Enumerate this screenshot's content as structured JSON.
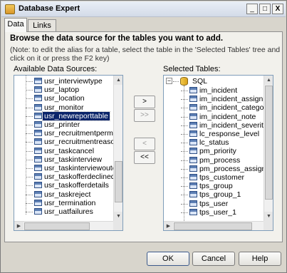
{
  "window": {
    "title": "Database Expert",
    "controls": {
      "minimize": "_",
      "maximize": "□",
      "close": "X"
    }
  },
  "tabs": [
    {
      "label": "Data",
      "active": true
    },
    {
      "label": "Links",
      "active": false
    }
  ],
  "content": {
    "heading": "Browse the data source for the tables you want to add.",
    "note": "(Note: to edit the alias for a table, select the table in the 'Selected Tables' tree and click on it or press the F2 key)"
  },
  "available": {
    "label": "Available Data Sources:",
    "items": [
      {
        "label": "usr_interviewtype"
      },
      {
        "label": "usr_laptop"
      },
      {
        "label": "usr_location"
      },
      {
        "label": "usr_monitor"
      },
      {
        "label": "usr_newreporttable",
        "selected": true
      },
      {
        "label": "usr_printer"
      },
      {
        "label": "usr_recruitmentpermtemp"
      },
      {
        "label": "usr_recruitmentreason"
      },
      {
        "label": "usr_taskcancel"
      },
      {
        "label": "usr_taskinterview"
      },
      {
        "label": "usr_taskinterviewoutcome"
      },
      {
        "label": "usr_taskofferdeclined"
      },
      {
        "label": "usr_taskofferdetails"
      },
      {
        "label": "usr_taskreject"
      },
      {
        "label": "usr_termination"
      },
      {
        "label": "usr_uatfailures"
      }
    ]
  },
  "transfer": {
    "add": ">",
    "add_all": ">>",
    "remove": "<",
    "remove_all": "<<"
  },
  "selected": {
    "label": "Selected Tables:",
    "root": {
      "label": "SQL",
      "expander": "−"
    },
    "items": [
      {
        "label": "im_incident"
      },
      {
        "label": "im_incident_assignment"
      },
      {
        "label": "im_incident_category"
      },
      {
        "label": "im_incident_note"
      },
      {
        "label": "im_incident_severity"
      },
      {
        "label": "lc_response_level"
      },
      {
        "label": "lc_status"
      },
      {
        "label": "pm_priority"
      },
      {
        "label": "pm_process"
      },
      {
        "label": "pm_process_assignment"
      },
      {
        "label": "tps_customer"
      },
      {
        "label": "tps_group"
      },
      {
        "label": "tps_group_1"
      },
      {
        "label": "tps_user"
      },
      {
        "label": "tps_user_1"
      }
    ]
  },
  "buttons": {
    "ok": "OK",
    "cancel": "Cancel",
    "help": "Help"
  }
}
